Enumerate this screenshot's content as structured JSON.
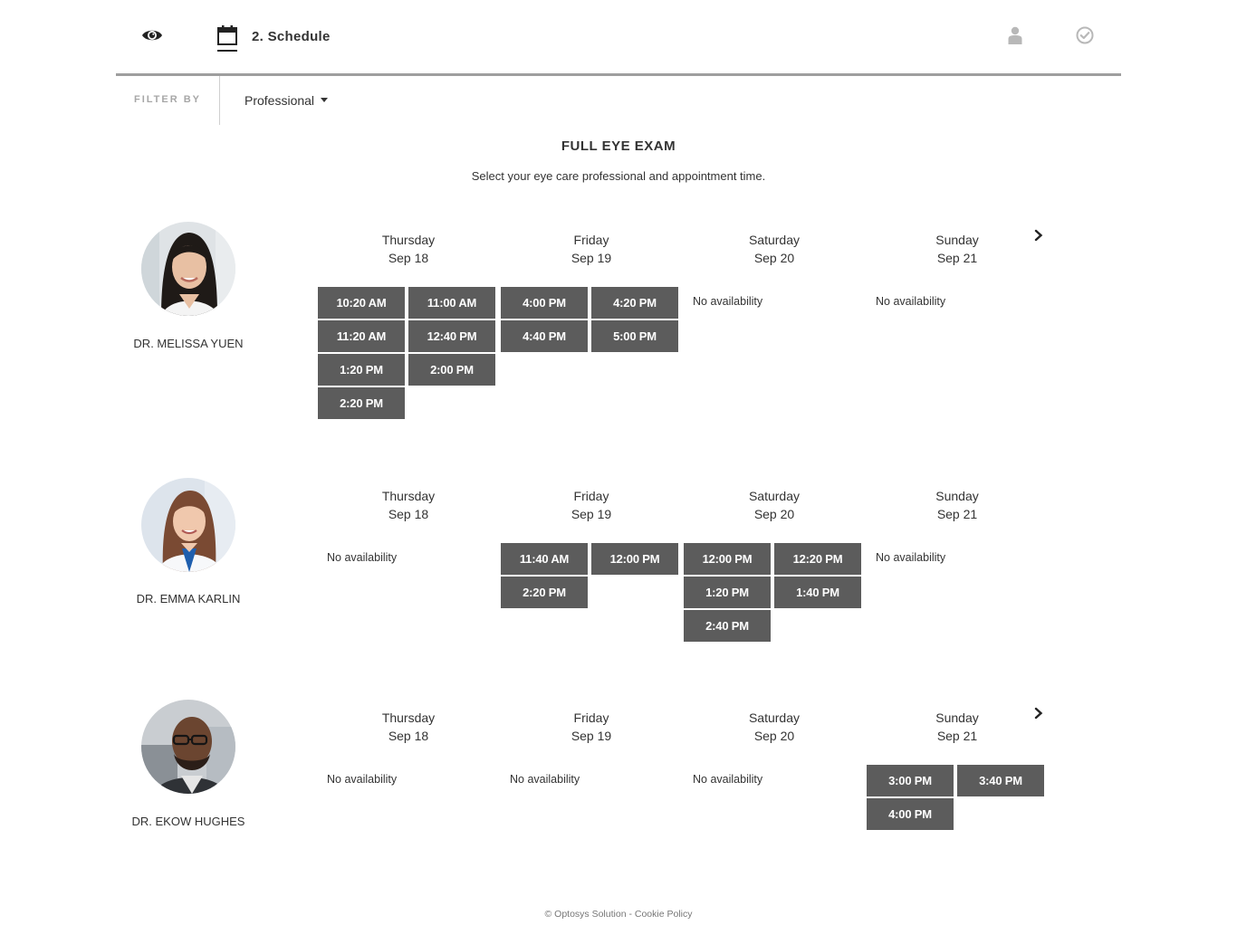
{
  "header": {
    "step_title": "2. Schedule"
  },
  "filter": {
    "label": "FILTER BY",
    "selected": "Professional"
  },
  "exam": {
    "title": "FULL EYE EXAM",
    "subtitle": "Select your eye care professional and appointment time."
  },
  "days": [
    {
      "weekday": "Thursday",
      "date": "Sep 18"
    },
    {
      "weekday": "Friday",
      "date": "Sep 19"
    },
    {
      "weekday": "Saturday",
      "date": "Sep 20"
    },
    {
      "weekday": "Sunday",
      "date": "Sep 21"
    }
  ],
  "no_availability_text": "No availability",
  "doctors": [
    {
      "name": "DR. MELISSA YUEN",
      "slots": [
        [
          "10:20 AM",
          "11:00 AM",
          "11:20 AM",
          "12:40 PM",
          "1:20 PM",
          "2:00 PM",
          "2:20 PM"
        ],
        [
          "4:00 PM",
          "4:20 PM",
          "4:40 PM",
          "5:00 PM"
        ],
        [],
        []
      ]
    },
    {
      "name": "DR. EMMA KARLIN",
      "slots": [
        [],
        [
          "11:40 AM",
          "12:00 PM",
          "2:20 PM"
        ],
        [
          "12:00 PM",
          "12:20 PM",
          "1:20 PM",
          "1:40 PM",
          "2:40 PM"
        ],
        []
      ]
    },
    {
      "name": "DR. EKOW HUGHES",
      "slots": [
        [],
        [],
        [],
        [
          "3:00 PM",
          "3:40 PM",
          "4:00 PM"
        ]
      ]
    }
  ],
  "footer": {
    "copyright": "© Optosys Solution",
    "separator": " - ",
    "cookie_link": "Cookie Policy"
  },
  "colors": {
    "slot_bg": "#5c5c5c",
    "slot_text": "#ffffff",
    "header_rule": "#9e9e9e"
  },
  "icons": [
    "eye-icon",
    "calendar-icon",
    "user-icon",
    "check-circle-icon",
    "caret-down-icon",
    "chevron-right-icon"
  ]
}
